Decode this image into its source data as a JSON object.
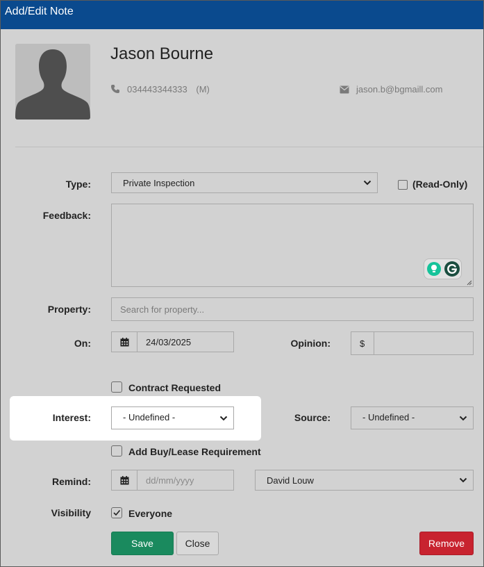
{
  "dialog": {
    "title": "Add/Edit Note"
  },
  "contact": {
    "name": "Jason Bourne",
    "phone": "034443344333",
    "phone_type": "(M)",
    "email": "jason.b@bgmaill.com"
  },
  "form": {
    "type": {
      "label": "Type:",
      "value": "Private Inspection"
    },
    "read_only": {
      "label": "(Read-Only)",
      "checked": false
    },
    "feedback": {
      "label": "Feedback:",
      "value": ""
    },
    "property": {
      "label": "Property:",
      "placeholder": "Search for property..."
    },
    "on": {
      "label": "On:",
      "value": "24/03/2025"
    },
    "opinion": {
      "label": "Opinion:",
      "prefix": "$",
      "value": ""
    },
    "contract_requested": {
      "label": "Contract Requested",
      "checked": false
    },
    "interest": {
      "label": "Interest:",
      "value": "- Undefined -"
    },
    "source": {
      "label": "Source:",
      "value": "- Undefined -"
    },
    "add_requirement": {
      "label": "Add Buy/Lease Requirement",
      "checked": false
    },
    "remind": {
      "label": "Remind:",
      "placeholder": "dd/mm/yyyy",
      "user": "David Louw"
    },
    "visibility": {
      "label": "Visibility",
      "option": "Everyone",
      "checked": true
    }
  },
  "buttons": {
    "save": "Save",
    "close": "Close",
    "remove": "Remove"
  },
  "colors": {
    "titlebar": "#0a4a8e",
    "save": "#1a8a5e",
    "remove": "#c8232f",
    "grammarly": "#15c39a"
  },
  "icons": [
    "avatar-icon",
    "phone-icon",
    "email-icon",
    "calendar-icon",
    "chevron-down-icon",
    "grammarly-icon",
    "lightbulb-icon",
    "check-icon",
    "resize-handle-icon"
  ]
}
